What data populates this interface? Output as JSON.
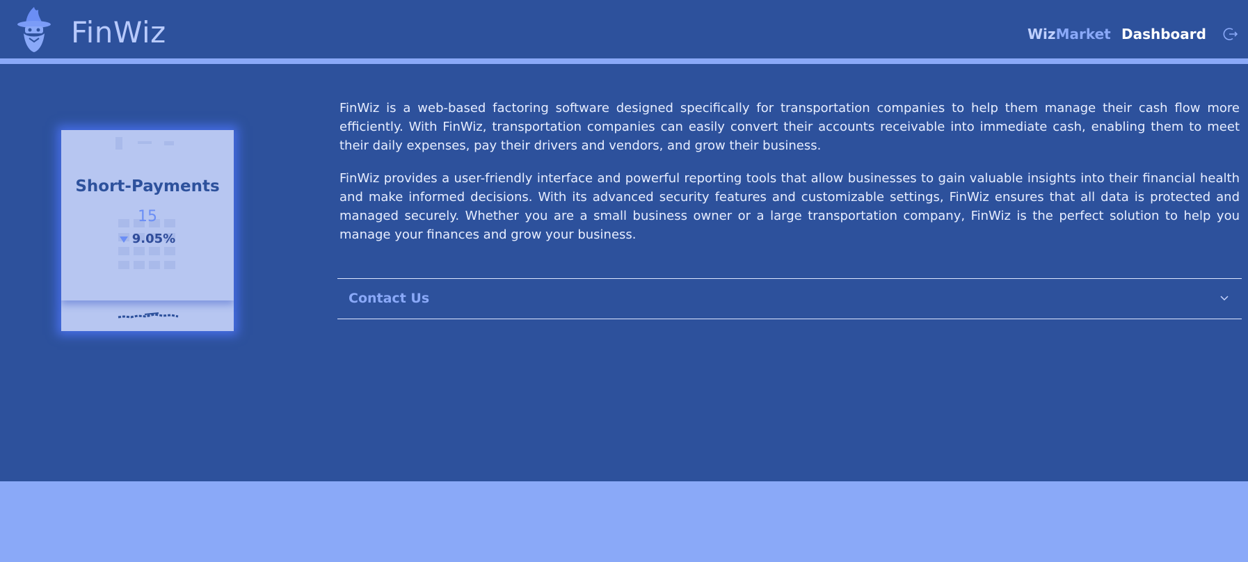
{
  "header": {
    "brand": "FinWiz",
    "nav": {
      "market_prefix": "Wiz",
      "market_suffix": "Market",
      "dashboard": "Dashboard"
    },
    "icons": {
      "logo": "wizard-logo-icon",
      "logout": "logout-icon"
    }
  },
  "card": {
    "title": "Short-Payments",
    "value": "15",
    "change": "9.05%",
    "change_direction": "down"
  },
  "about": {
    "paragraph1": "FinWiz is a web-based factoring software designed specifically for transportation companies to help them manage their cash flow more efficiently. With FinWiz, transportation companies can easily convert their accounts receivable into immediate cash, enabling them to meet their daily expenses, pay their drivers and vendors, and grow their business.",
    "paragraph2": "FinWiz provides a user-friendly interface and powerful reporting tools that allow businesses to gain valuable insights into their financial health and make informed decisions. With its advanced security features and customizable settings, FinWiz ensures that all data is protected and managed securely. Whether you are a small business owner or a large transportation company, FinWiz is the perfect solution to help you manage your finances and grow your business."
  },
  "contact": {
    "label": "Contact Us",
    "expanded": false
  },
  "colors": {
    "background": "#2d519c",
    "accent": "#8aa9f8",
    "card": "#b7c6f1",
    "text": "#eef2ff"
  }
}
